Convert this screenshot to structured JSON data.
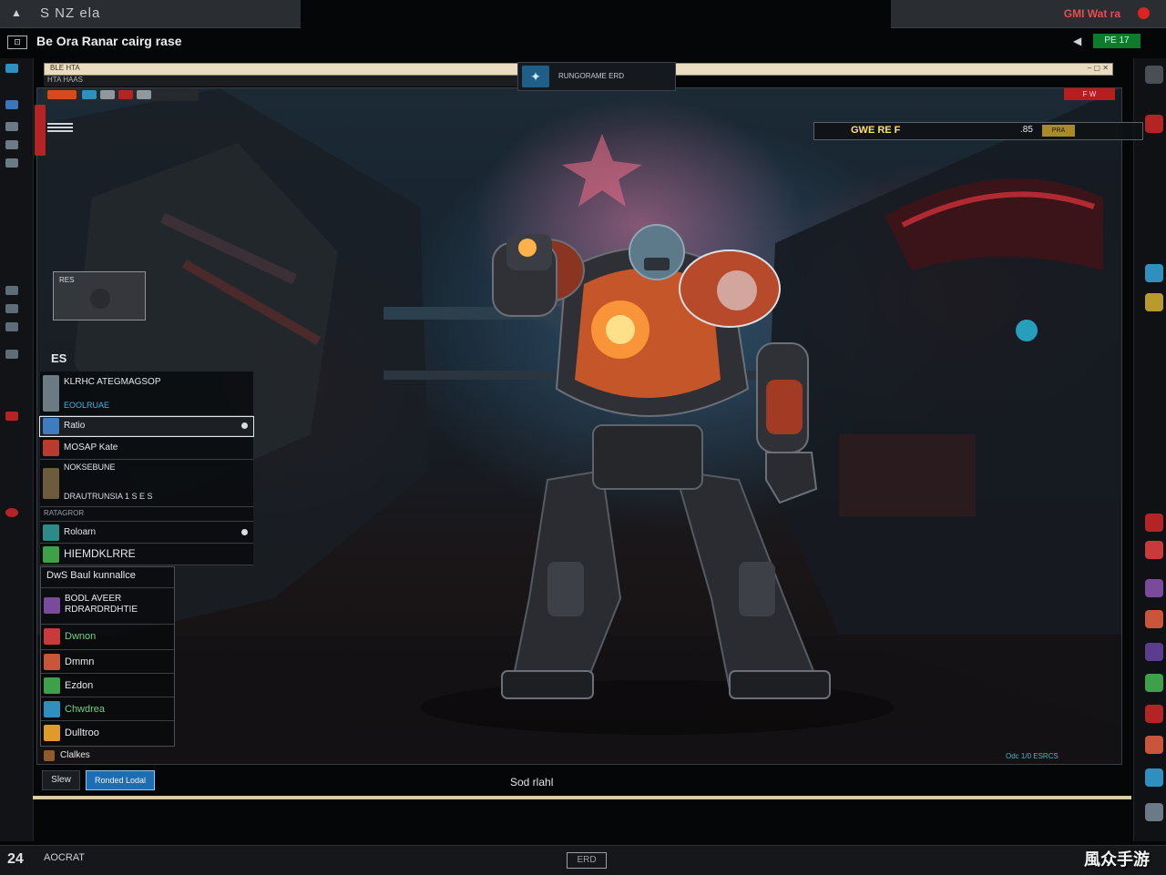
{
  "window": {
    "top_tab_title": "S NZ ela",
    "top_right_label": "GMI Wat ra",
    "title": "Be Ora Ranar cairg rase",
    "battery_label": "PE 17"
  },
  "viewport": {
    "address_text": "BLE HTA",
    "sub_text": "HTA HAAS",
    "center_badge_text": "RUNGORAME ERD",
    "red_chip": "F W",
    "hud": {
      "left": "GWE RE F",
      "right": ".85",
      "chip": "PRA"
    },
    "mini_card_title": "RES"
  },
  "list": {
    "header": "ES",
    "rows": [
      {
        "label": "KLRHC ATEGMAGSOP",
        "sub": "EOOLRUAE",
        "color": "#6c7a86"
      },
      {
        "label": "Ratio",
        "sub": "",
        "color": "#3e7bbf",
        "selected": true
      },
      {
        "label": "MOSAP Kate",
        "sub": "",
        "color": "#b83b2e"
      },
      {
        "label": "NOKSEBUNE",
        "sub": "DRAUTRUNSIA 1 S E S",
        "color": "#6d5b3e"
      },
      {
        "label": "RATAGROR",
        "sub": "",
        "color": "#4a4f56"
      },
      {
        "label": "Roloarn",
        "sub": "",
        "color": "#2e8a8a"
      },
      {
        "label": "HIEMDKLRRE",
        "sub": "",
        "color": "#3fa04a"
      }
    ]
  },
  "quests": {
    "header": "DwS Baul kunnallce",
    "items": [
      {
        "label": "BODL AVEER RDRARDRDHTIE",
        "color": "#e7eaee",
        "icon": "#7a4a9c"
      },
      {
        "label": "Dwnon",
        "color": "#6fd08a",
        "icon": "#c93a3a"
      },
      {
        "label": "Dmmn",
        "color": "#e7eaee",
        "icon": "#c9563a"
      },
      {
        "label": "Ezdon",
        "color": "#e7eaee",
        "icon": "#3fa04a"
      },
      {
        "label": "Chwdrea",
        "color": "#6fd08a",
        "icon": "#2f8fbf"
      },
      {
        "label": "Dulltroo",
        "color": "#e7eaee",
        "icon": "#e09a2c"
      },
      {
        "label": "Clalkes",
        "color": "#e7eaee",
        "icon": "#8f5a2c"
      }
    ]
  },
  "bottom": {
    "btn_a": "Slew",
    "btn_b": "Ronded Lodal",
    "status_mid": "Sod rlahl",
    "status_right": "Odc 1/0    ESRCS"
  },
  "taskbar": {
    "logo": "24",
    "label": "AOCRAT",
    "mid_label": "ERD",
    "watermark": "風众手游"
  },
  "colors": {
    "accent_blue": "#1d6db3",
    "accent_red": "#b81d1d",
    "hud_yellow": "#ffe06b"
  }
}
